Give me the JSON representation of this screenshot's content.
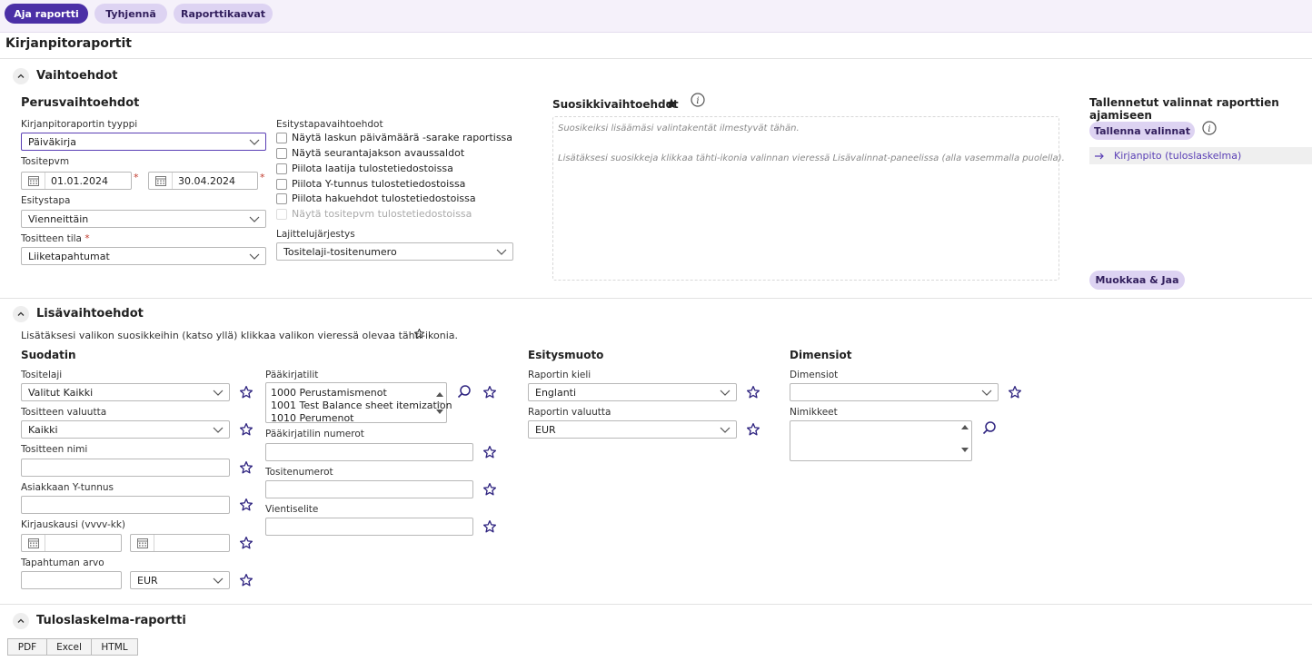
{
  "toolbar": {
    "run_label": "Aja raportti",
    "clear_label": "Tyhjennä",
    "templates_label": "Raporttikaavat"
  },
  "page_title": "Kirjanpitoraportit",
  "options": {
    "title": "Vaihtoehdot",
    "basic": {
      "title": "Perusvaihtoehdot",
      "report_type_label": "Kirjanpitoraportin tyyppi",
      "report_type_value": "Päiväkirja",
      "voucher_date_label": "Tositepvm",
      "date_from": "01.01.2024",
      "date_to": "30.04.2024",
      "presentation_label": "Esitystapa",
      "presentation_value": "Vienneittäin",
      "voucher_state_label": "Tositteen tila",
      "voucher_state_value": "Liiketapahtumat"
    },
    "presentation_options": {
      "label": "Esitystapavaihtoehdot",
      "checkboxes": [
        "Näytä laskun päivämäärä -sarake raportissa",
        "Näytä seurantajakson avaussaldot",
        "Piilota laatija tulostetiedostoissa",
        "Piilota Y-tunnus tulostetiedostoissa",
        "Piilota hakuehdot tulostetiedostoissa",
        "Näytä tositepvm tulostetiedostoissa"
      ],
      "sort_label": "Lajittelujärjestys",
      "sort_value": "Tositelaji-tositenumero"
    },
    "favorites": {
      "title": "Suosikkivaihtoehdot",
      "text1": "Suosikeiksi lisäämäsi valintakentät ilmestyvät tähän.",
      "text2": "Lisätäksesi suosikkeja klikkaa tähti-ikonia valinnan vieressä Lisävalinnat-paneelissa (alla vasemmalla puolella)."
    },
    "saved": {
      "title": "Tallennetut valinnat raporttien ajamiseen",
      "save_label": "Tallenna valinnat",
      "item_label": "Kirjanpito (tuloslaskelma)",
      "edit_share_label": "Muokkaa & Jaa"
    }
  },
  "additional": {
    "title": "Lisävaihtoehdot",
    "hint": "Lisätäksesi valikon suosikkeihin (katso yllä) klikkaa valikon vieressä olevaa tähti-ikonia.",
    "filter": {
      "title": "Suodatin",
      "voucher_type_label": "Tositelaji",
      "voucher_type_value": "Valitut Kaikki",
      "currency_label": "Tositteen valuutta",
      "currency_value": "Kaikki",
      "voucher_name_label": "Tositteen nimi",
      "customer_id_label": "Asiakkaan Y-tunnus",
      "period_label": "Kirjauskausi (vvvv-kk)",
      "amount_label": "Tapahtuman arvo",
      "amount_currency": "EUR",
      "accounts_label": "Pääkirjatilit",
      "accounts": [
        "1000 Perustamismenot",
        "1001 Test Balance sheet itemization",
        "1010 Perumenot"
      ],
      "account_number_label": "Pääkirjatilin numerot",
      "voucher_numbers_label": "Tositenumerot",
      "entry_desc_label": "Vientiselite"
    },
    "format": {
      "title": "Esitysmuoto",
      "language_label": "Raportin kieli",
      "language_value": "Englanti",
      "currency_label": "Raportin valuutta",
      "currency_value": "EUR"
    },
    "dimensions": {
      "title": "Dimensiot",
      "dimensions_label": "Dimensiot",
      "names_label": "Nimikkeet"
    }
  },
  "income_report": {
    "title": "Tuloslaskelma-raportti",
    "tabs": [
      "PDF",
      "Excel",
      "HTML"
    ]
  },
  "colors": {
    "primary": "#4b2fa6",
    "secondary": "#ddd3f2",
    "link": "#5a3fb5",
    "required": "#c0392b"
  }
}
